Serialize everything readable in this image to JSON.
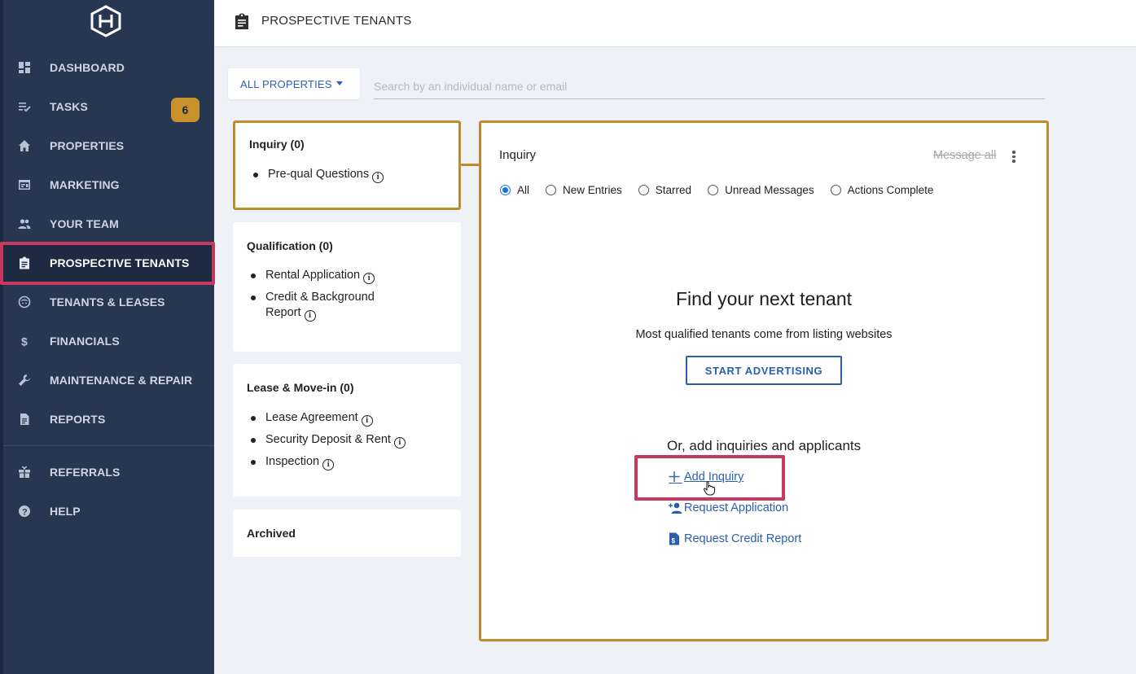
{
  "sidebar": {
    "items": [
      {
        "key": "dashboard",
        "label": "DASHBOARD",
        "icon": "dashboard-icon"
      },
      {
        "key": "tasks",
        "label": "TASKS",
        "icon": "tasks-icon",
        "badge": "6"
      },
      {
        "key": "properties",
        "label": "PROPERTIES",
        "icon": "home-icon"
      },
      {
        "key": "marketing",
        "label": "MARKETING",
        "icon": "marketing-icon"
      },
      {
        "key": "your-team",
        "label": "YOUR TEAM",
        "icon": "team-icon"
      },
      {
        "key": "prospective-tenants",
        "label": "PROSPECTIVE TENANTS",
        "icon": "clipboard-icon",
        "active": true
      },
      {
        "key": "tenants-leases",
        "label": "TENANTS & LEASES",
        "icon": "tenant-icon"
      },
      {
        "key": "financials",
        "label": "FINANCIALS",
        "icon": "dollar-icon"
      },
      {
        "key": "maintenance",
        "label": "MAINTENANCE & REPAIR",
        "icon": "wrench-icon"
      },
      {
        "key": "reports",
        "label": "REPORTS",
        "icon": "report-icon"
      },
      {
        "key": "referrals",
        "label": "REFERRALS",
        "icon": "gift-icon"
      },
      {
        "key": "help",
        "label": "HELP",
        "icon": "help-icon"
      }
    ]
  },
  "header": {
    "title": "PROSPECTIVE TENANTS",
    "icon": "clipboard-icon"
  },
  "filters": {
    "property_select": "ALL PROPERTIES",
    "search_placeholder": "Search by an individual name or email"
  },
  "stages": [
    {
      "title": "Inquiry (0)",
      "items": [
        "Pre-qual Questions"
      ],
      "selected": true
    },
    {
      "title": "Qualification (0)",
      "items": [
        "Rental Application",
        "Credit & Background",
        "Report"
      ]
    },
    {
      "title": "Lease & Move-in (0)",
      "items": [
        "Lease Agreement",
        "Security Deposit & Rent",
        "Inspection"
      ]
    },
    {
      "title": "Archived",
      "items": []
    }
  ],
  "panel": {
    "title": "Inquiry",
    "message_all": "Message all",
    "filters": [
      "All",
      "New Entries",
      "Starred",
      "Unread Messages",
      "Actions Complete"
    ],
    "selected_filter": "All",
    "empty_title": "Find your next tenant",
    "empty_subtitle": "Most qualified tenants come from listing websites",
    "start_button": "START ADVERTISING",
    "or_add": "Or, add inquiries and applicants",
    "actions": {
      "add_inquiry": "Add Inquiry",
      "request_application": "Request Application",
      "request_credit": "Request Credit Report"
    }
  },
  "colors": {
    "sidebar_bg": "#273651",
    "accent_gold": "#c08a2f",
    "highlight_red": "#c8385f",
    "link_blue": "#2a5fad"
  }
}
